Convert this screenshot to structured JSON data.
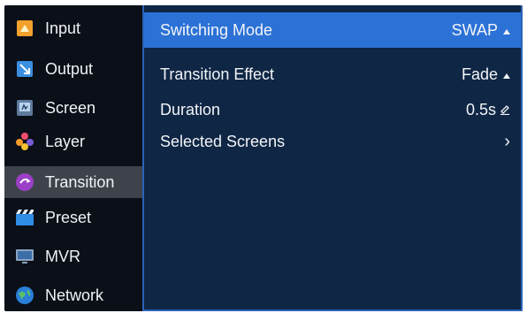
{
  "sidebar": {
    "items": [
      {
        "label": "Input",
        "icon": "input-icon"
      },
      {
        "label": "Output",
        "icon": "output-icon"
      },
      {
        "label": "Screen",
        "icon": "screen-icon"
      },
      {
        "label": "Layer",
        "icon": "layer-icon"
      },
      {
        "label": "Transition",
        "icon": "transition-icon",
        "active": true
      },
      {
        "label": "Preset",
        "icon": "preset-icon"
      },
      {
        "label": "MVR",
        "icon": "mvr-icon"
      },
      {
        "label": "Network",
        "icon": "network-icon"
      }
    ]
  },
  "main": {
    "rows": [
      {
        "label": "Switching Mode",
        "value": "SWAP",
        "control": "dropdown"
      },
      {
        "label": "Transition Effect",
        "value": "Fade",
        "control": "dropdown"
      },
      {
        "label": "Duration",
        "value": "0.5s",
        "control": "edit"
      },
      {
        "label": "Selected Screens",
        "value": "",
        "control": "submenu"
      }
    ]
  },
  "colors": {
    "highlight": "#2c72d6",
    "panel": "#0f2644",
    "sidebar": "#0a0f18",
    "active_item": "#3e434b",
    "border": "#2a63b7"
  }
}
